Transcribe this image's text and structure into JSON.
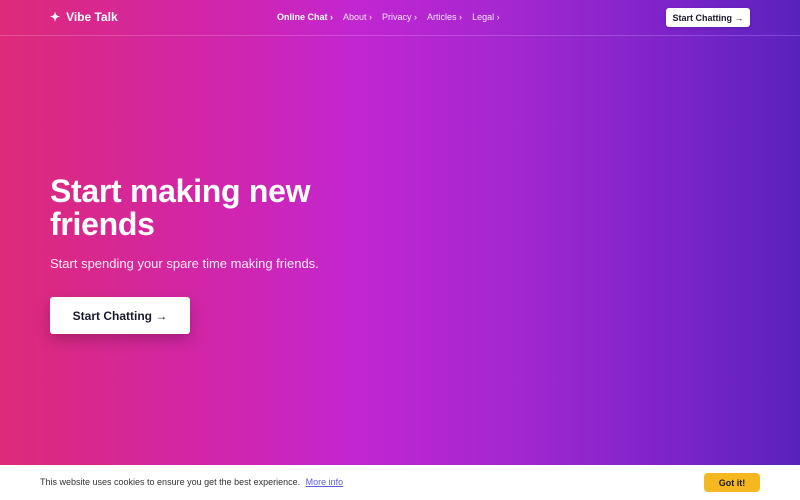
{
  "brand": {
    "icon": "sparkle-icon",
    "glyph": "✦",
    "name": "Vibe Talk"
  },
  "nav": {
    "items": [
      {
        "label": "Online Chat ›",
        "active": true
      },
      {
        "label": "About ›",
        "active": false
      },
      {
        "label": "Privacy ›",
        "active": false
      },
      {
        "label": "Articles ›",
        "active": false
      },
      {
        "label": "Legal ›",
        "active": false
      }
    ],
    "cta_label": "Start Chatting →"
  },
  "hero": {
    "title": "Start making new friends",
    "subtitle": "Start spending your spare time making friends.",
    "cta_label": "Start Chatting →"
  },
  "cookie": {
    "text": "This website uses cookies to ensure you get the best experience.",
    "link_label": "More info",
    "button_label": "Got it!"
  },
  "colors": {
    "gradient_start": "#de2a78",
    "gradient_mid": "#c126d2",
    "gradient_end": "#5a22bd",
    "cookie_button": "#f5b820",
    "link": "#5a5fd8"
  }
}
